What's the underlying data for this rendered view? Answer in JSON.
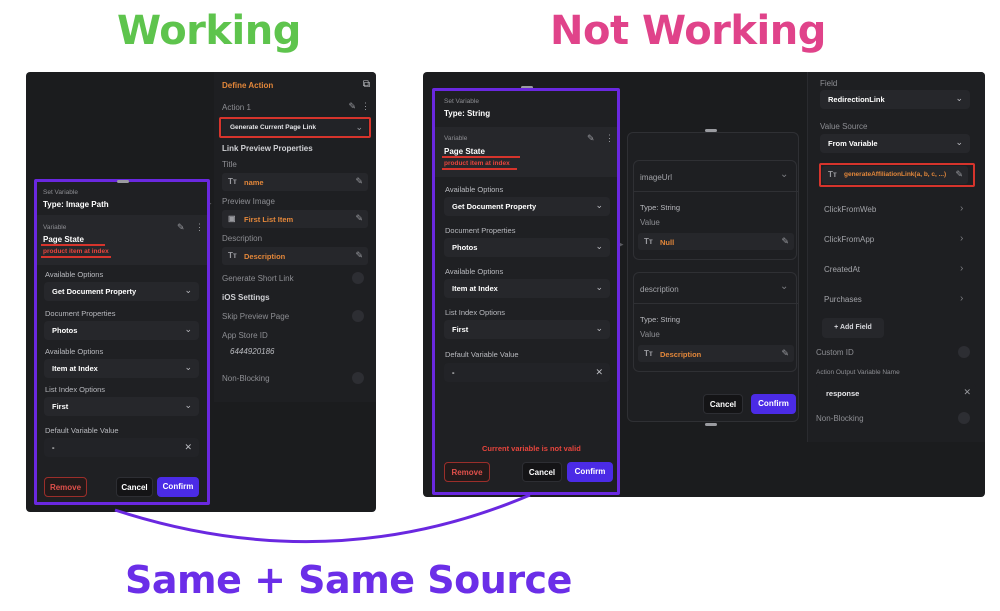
{
  "titles": {
    "working": "Working",
    "not_working": "Not Working",
    "bottom": "Same + Same Source"
  },
  "left": {
    "define_action": {
      "header": "Define Action",
      "action_label": "Action 1",
      "action_value": "Generate Current Page Link",
      "link_preview": "Link Preview Properties",
      "title_label": "Title",
      "title_value": "name",
      "preview_image_label": "Preview Image",
      "preview_image_value": "First List Item",
      "description_label": "Description",
      "description_value": "Description",
      "generate_short_link": "Generate Short Link",
      "ios_settings": "iOS Settings",
      "skip_preview_page": "Skip Preview Page",
      "app_store_id_label": "App Store ID",
      "app_store_id_value": "6444920186",
      "non_blocking": "Non-Blocking"
    },
    "set_variable": {
      "heading": "Set Variable",
      "type": "Type: Image Path",
      "variable_label": "Variable",
      "variable_value": "Page State",
      "variable_sub": "product item at index",
      "available_options_1_label": "Available Options",
      "available_options_1_value": "Get Document Property",
      "document_properties_label": "Document Properties",
      "document_properties_value": "Photos",
      "available_options_2_label": "Available Options",
      "available_options_2_value": "Item at Index",
      "list_index_label": "List Index Options",
      "list_index_value": "First",
      "default_value_label": "Default Variable Value",
      "default_value": "-",
      "remove": "Remove",
      "cancel": "Cancel",
      "confirm": "Confirm"
    }
  },
  "right": {
    "set_variable": {
      "heading": "Set Variable",
      "type": "Type: String",
      "variable_label": "Variable",
      "variable_value": "Page State",
      "variable_sub": "product item at index",
      "available_options_1_label": "Available Options",
      "available_options_1_value": "Get Document Property",
      "document_properties_label": "Document Properties",
      "document_properties_value": "Photos",
      "available_options_2_label": "Available Options",
      "available_options_2_value": "Item at Index",
      "list_index_label": "List Index Options",
      "list_index_value": "First",
      "default_value_label": "Default Variable Value",
      "default_value": "-",
      "error": "Current variable is not valid",
      "remove": "Remove",
      "cancel": "Cancel",
      "confirm": "Confirm"
    },
    "middle": {
      "imageurl_title": "imageUrl",
      "type1": "Type: String",
      "value_label1": "Value",
      "value1": "Null",
      "description_title": "description",
      "type2": "Type: String",
      "value_label2": "Value",
      "value2": "Description",
      "cancel": "Cancel",
      "confirm": "Confirm"
    },
    "fields": {
      "field_label": "Field",
      "field_value": "RedirectionLink",
      "value_source_label": "Value Source",
      "value_source_value": "From Variable",
      "function_value": "generateAffiliationLink(a, b, c, ...)",
      "items": [
        "ClickFromWeb",
        "ClickFromApp",
        "CreatedAt",
        "Purchases"
      ],
      "add_field": "Add Field",
      "custom_id": "Custom ID",
      "output_name_label": "Action Output Variable Name",
      "output_name_value": "response",
      "non_blocking": "Non-Blocking"
    }
  }
}
